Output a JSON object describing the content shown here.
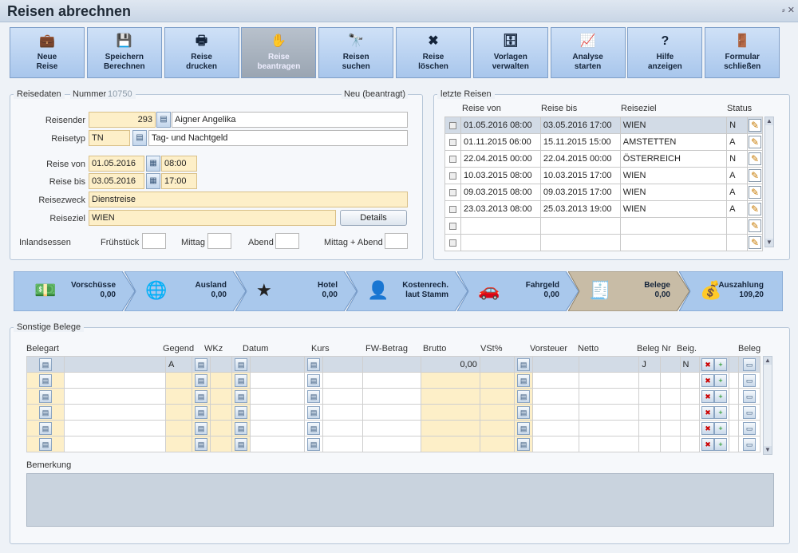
{
  "window": {
    "title": "Reisen abrechnen"
  },
  "toolbar": [
    {
      "l1": "Neue",
      "l2": "Reise",
      "icon": "new-trip-icon",
      "glyph": "💼",
      "enabled": true
    },
    {
      "l1": "Speichern",
      "l2": "Berechnen",
      "icon": "save-icon",
      "glyph": "💾",
      "enabled": true
    },
    {
      "l1": "Reise",
      "l2": "drucken",
      "icon": "printer-icon",
      "glyph": "🖶",
      "enabled": true
    },
    {
      "l1": "Reise",
      "l2": "beantragen",
      "icon": "hand-icon",
      "glyph": "✋",
      "enabled": false
    },
    {
      "l1": "Reisen",
      "l2": "suchen",
      "icon": "binoculars-icon",
      "glyph": "🔭",
      "enabled": true
    },
    {
      "l1": "Reise",
      "l2": "löschen",
      "icon": "delete-icon",
      "glyph": "✖",
      "enabled": true
    },
    {
      "l1": "Vorlagen",
      "l2": "verwalten",
      "icon": "templates-icon",
      "glyph": "🗄",
      "enabled": true
    },
    {
      "l1": "Analyse",
      "l2": "starten",
      "icon": "chart-icon",
      "glyph": "📈",
      "enabled": true
    },
    {
      "l1": "Hilfe",
      "l2": "anzeigen",
      "icon": "help-icon",
      "glyph": "?",
      "enabled": true
    },
    {
      "l1": "Formular",
      "l2": "schließen",
      "icon": "exit-door-icon",
      "glyph": "🚪",
      "enabled": true
    }
  ],
  "reisedaten": {
    "legend": "Reisedaten",
    "nummer_label": "Nummer",
    "nummer": "10750",
    "status": "Neu (beantragt)",
    "reisender_label": "Reisender",
    "reisender_nr": "293",
    "reisender_name": "Aigner Angelika",
    "reisetyp_label": "Reisetyp",
    "reisetyp_code": "TN",
    "reisetyp_text": "Tag- und Nachtgeld",
    "von_label": "Reise von",
    "von_datum": "01.05.2016",
    "von_zeit": "08:00",
    "bis_label": "Reise bis",
    "bis_datum": "03.05.2016",
    "bis_zeit": "17:00",
    "zweck_label": "Reisezweck",
    "zweck": "Dienstreise",
    "ziel_label": "Reiseziel",
    "ziel": "WIEN",
    "details": "Details",
    "inland_label": "Inlandsessen",
    "fruehstueck": "Frühstück",
    "mittag": "Mittag",
    "abend": "Abend",
    "mittag_abend": "Mittag + Abend"
  },
  "letzte": {
    "legend": "letzte Reisen",
    "headers": [
      "Reise von",
      "Reise bis",
      "Reiseziel",
      "Status"
    ],
    "rows": [
      [
        "01.05.2016 08:00",
        "03.05.2016 17:00",
        "WIEN",
        "N"
      ],
      [
        "01.11.2015 06:00",
        "15.11.2015 15:00",
        "AMSTETTEN",
        "A"
      ],
      [
        "22.04.2015 00:00",
        "22.04.2015 00:00",
        "ÖSTERREICH",
        "N"
      ],
      [
        "10.03.2015 08:00",
        "10.03.2015 17:00",
        "WIEN",
        "A"
      ],
      [
        "09.03.2015 08:00",
        "09.03.2015 17:00",
        "WIEN",
        "A"
      ],
      [
        "23.03.2013 08:00",
        "25.03.2013 19:00",
        "WIEN",
        "A"
      ],
      [
        "",
        "",
        "",
        ""
      ],
      [
        "",
        "",
        "",
        ""
      ]
    ]
  },
  "steps": [
    {
      "name": "Vorschüsse",
      "value": "0,00",
      "icon": "money-icon",
      "glyph": "💵",
      "active": false
    },
    {
      "name": "Ausland",
      "value": "0,00",
      "icon": "globe-icon",
      "glyph": "🌐",
      "active": false
    },
    {
      "name": "Hotel",
      "value": "0,00",
      "icon": "stars-icon",
      "glyph": "★",
      "active": false
    },
    {
      "name": "Kostenrech.",
      "name2": "laut Stamm",
      "value": "",
      "icon": "person-icon",
      "glyph": "👤",
      "active": false
    },
    {
      "name": "Fahrgeld",
      "value": "0,00",
      "icon": "car-icon",
      "glyph": "🚗",
      "active": false
    },
    {
      "name": "Belege",
      "value": "0,00",
      "icon": "receipt-icon",
      "glyph": "🧾",
      "active": true
    },
    {
      "name": "Auszahlung",
      "value": "109,20",
      "icon": "cash-register-icon",
      "glyph": "💰",
      "active": false
    }
  ],
  "belege": {
    "legend": "Sonstige Belege",
    "headers": [
      "Belegart",
      "Gegend",
      "WKz",
      "Datum",
      "Kurs",
      "FW-Betrag",
      "Brutto",
      "VSt%",
      "Vorsteuer",
      "Netto",
      "Beleg Nr",
      "Beig.",
      "Beleg"
    ],
    "first": {
      "gegend": "A",
      "brutto": "0,00",
      "belegnr": "J",
      "beig": "N"
    },
    "bemerkung_label": "Bemerkung"
  }
}
